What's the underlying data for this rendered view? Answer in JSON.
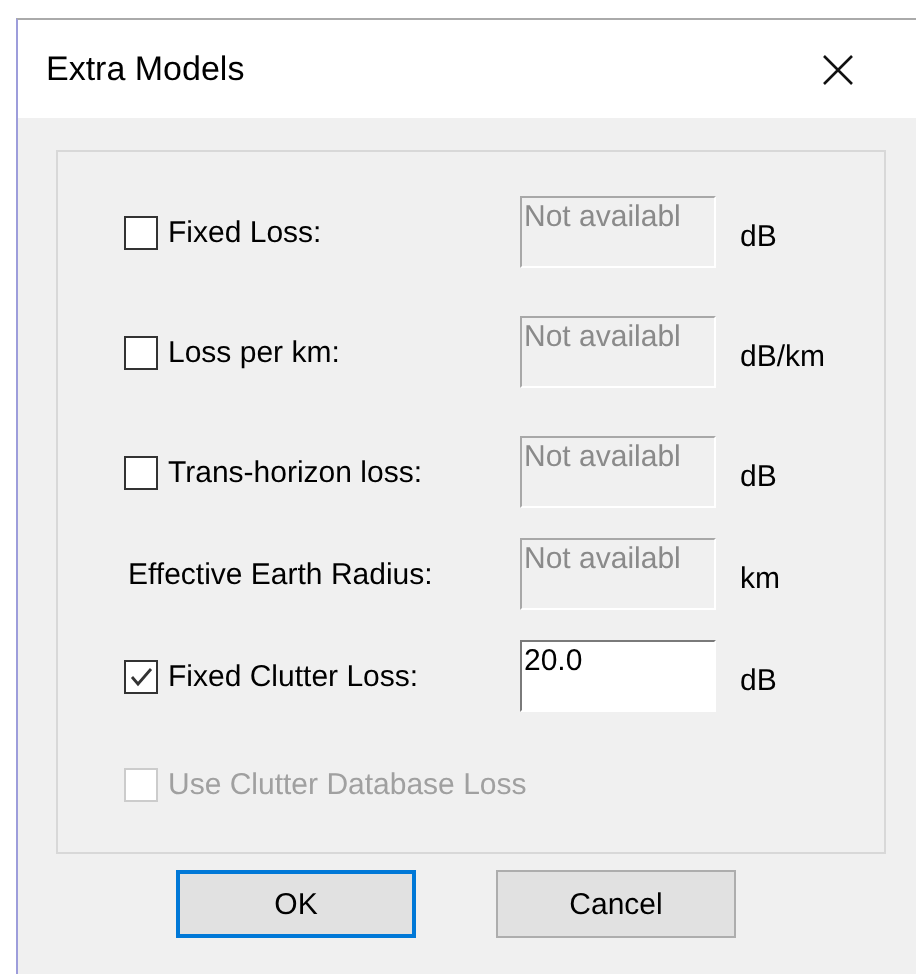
{
  "window": {
    "title": "Extra Models"
  },
  "rows": [
    {
      "kind": "checkbox",
      "label": "Fixed Loss:",
      "checked": false,
      "field": {
        "value": "Not availabl",
        "disabled": true
      },
      "unit": "dB"
    },
    {
      "kind": "checkbox",
      "label": "Loss per km:",
      "checked": false,
      "field": {
        "value": "Not availabl",
        "disabled": true
      },
      "unit": "dB/km"
    },
    {
      "kind": "checkbox",
      "label": "Trans-horizon loss:",
      "checked": false,
      "field": {
        "value": "Not availabl",
        "disabled": true
      },
      "unit": "dB"
    },
    {
      "kind": "label",
      "label": "Effective Earth Radius:",
      "field": {
        "value": "Not availabl",
        "disabled": true
      },
      "unit": "km"
    },
    {
      "kind": "checkbox",
      "label": "Fixed Clutter Loss:",
      "checked": true,
      "field": {
        "value": "20.0",
        "disabled": false
      },
      "unit": "dB"
    }
  ],
  "clutter_database": {
    "label": "Use Clutter Database Loss",
    "checked": false,
    "disabled": true
  },
  "buttons": [
    {
      "label": "OK",
      "default": true
    },
    {
      "label": "Cancel",
      "default": false
    }
  ]
}
